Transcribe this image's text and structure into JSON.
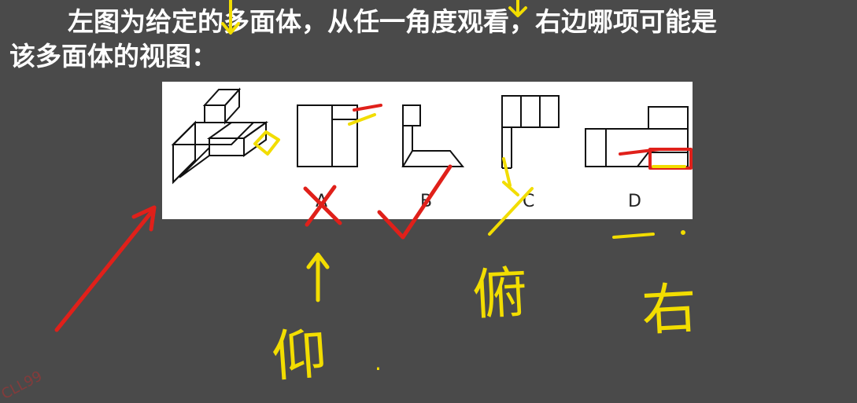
{
  "question": {
    "line1": "左图为给定的多面体，从任一角度观看，右边哪项可能是",
    "line2": "该多面体的视图："
  },
  "options": [
    {
      "label": "A",
      "result": "wrong"
    },
    {
      "label": "B",
      "result": "correct"
    },
    {
      "label": "C",
      "result": "wrong"
    },
    {
      "label": "D",
      "result": "none"
    }
  ],
  "annotations": {
    "view_top": "俯",
    "view_front": "仰",
    "view_right": "右"
  },
  "watermark": "CLL99",
  "colors": {
    "background": "#4a4a4a",
    "panel": "#ffffff",
    "ink_red": "#e0201a",
    "ink_yellow": "#f2dd00"
  }
}
